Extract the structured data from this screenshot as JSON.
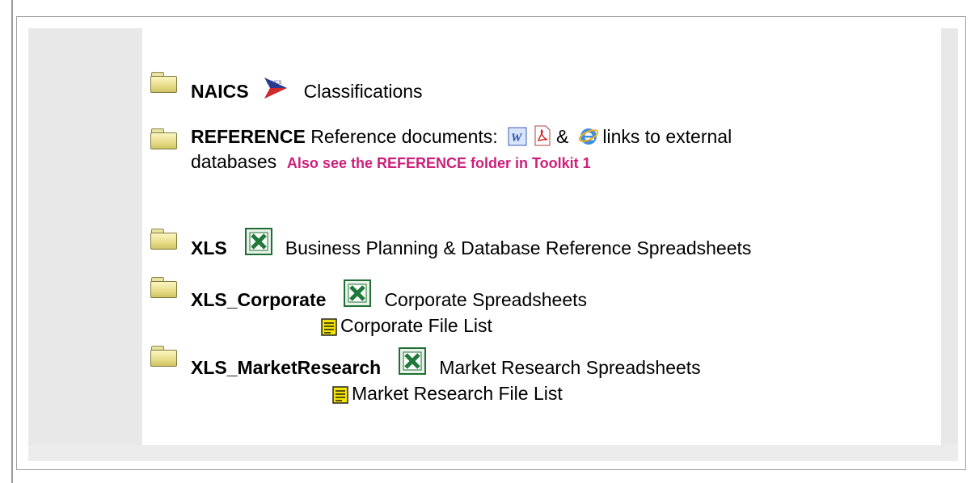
{
  "entries": {
    "naics": {
      "name": "NAICS",
      "description": "Classifications"
    },
    "reference": {
      "name": "REFERENCE",
      "description_before": "Reference documents:",
      "amp": "&",
      "description_after": "links to external",
      "description_line2": "databases",
      "note": "Also see the REFERENCE folder in Toolkit 1"
    },
    "xls": {
      "name": "XLS",
      "description": "Business Planning & Database Reference Spreadsheets"
    },
    "xls_corporate": {
      "name": "XLS_Corporate",
      "description": "Corporate Spreadsheets",
      "file_list": "Corporate File List"
    },
    "xls_marketresearch": {
      "name": "XLS_MarketResearch",
      "description": "Market Research Spreadsheets",
      "file_list": "Market Research File List"
    }
  },
  "naics_logo_text": "NAICS",
  "icons": {
    "folder": "folder-icon",
    "naics": "naics-logo-icon",
    "word": "word-doc-icon",
    "pdf": "pdf-icon",
    "ie": "internet-explorer-icon",
    "excel": "excel-icon",
    "text_file": "text-file-icon"
  },
  "colors": {
    "note": "#cc1f7a",
    "panel_grey": "#e8e8e8",
    "excel_green": "#1f7a3a"
  }
}
